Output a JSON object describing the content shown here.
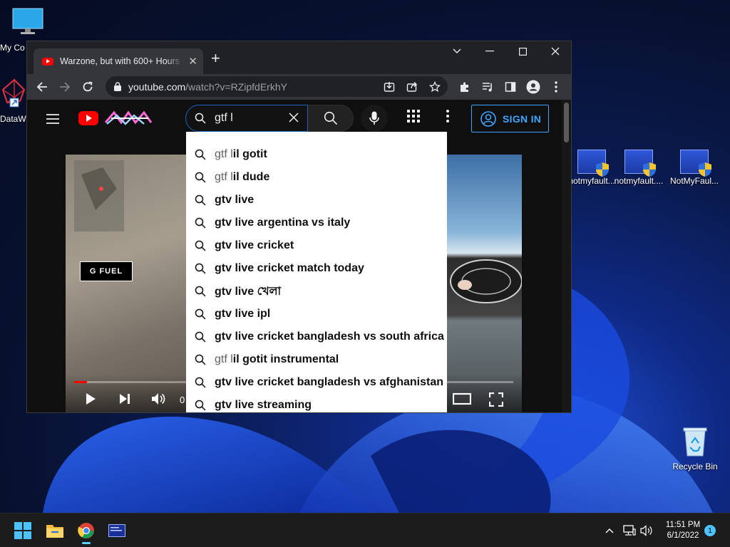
{
  "desktop": {
    "icons_left": [
      {
        "label": "My Co"
      },
      {
        "label": "DataW"
      }
    ],
    "icons_right": [
      {
        "label": "notmyfault..."
      },
      {
        "label": "notmyfault...."
      },
      {
        "label": "NotMyFaul..."
      }
    ],
    "recycle_bin": {
      "label": "Recycle Bin"
    }
  },
  "browser": {
    "tab_title": "Warzone, but with 600+ Hours o",
    "url_host": "youtube.com",
    "url_path": "/watch?v=RZipfdErkhY"
  },
  "youtube": {
    "search_value": "gtf l",
    "signin_label": "SIGN IN",
    "video_time": "0",
    "progress_percent": 3,
    "suggestions": [
      {
        "typed": "gtf l",
        "rest": "il gotit"
      },
      {
        "typed": "gtf l",
        "rest": "il dude"
      },
      {
        "typed": "",
        "rest": "gtv live"
      },
      {
        "typed": "",
        "rest": "gtv live argentina vs italy"
      },
      {
        "typed": "",
        "rest": "gtv live cricket"
      },
      {
        "typed": "",
        "rest": "gtv live cricket match today"
      },
      {
        "typed": "",
        "rest": "gtv live খেলা"
      },
      {
        "typed": "",
        "rest": "gtv live ipl"
      },
      {
        "typed": "",
        "rest": "gtv live cricket bangladesh vs south africa"
      },
      {
        "typed": "gtf l",
        "rest": "il gotit instrumental"
      },
      {
        "typed": "",
        "rest": "gtv live cricket bangladesh vs afghanistan"
      },
      {
        "typed": "",
        "rest": "gtv live streaming"
      }
    ]
  },
  "taskbar": {
    "time": "11:51 PM",
    "date": "6/1/2022",
    "notification_count": "1",
    "accent": "#60cdff"
  }
}
